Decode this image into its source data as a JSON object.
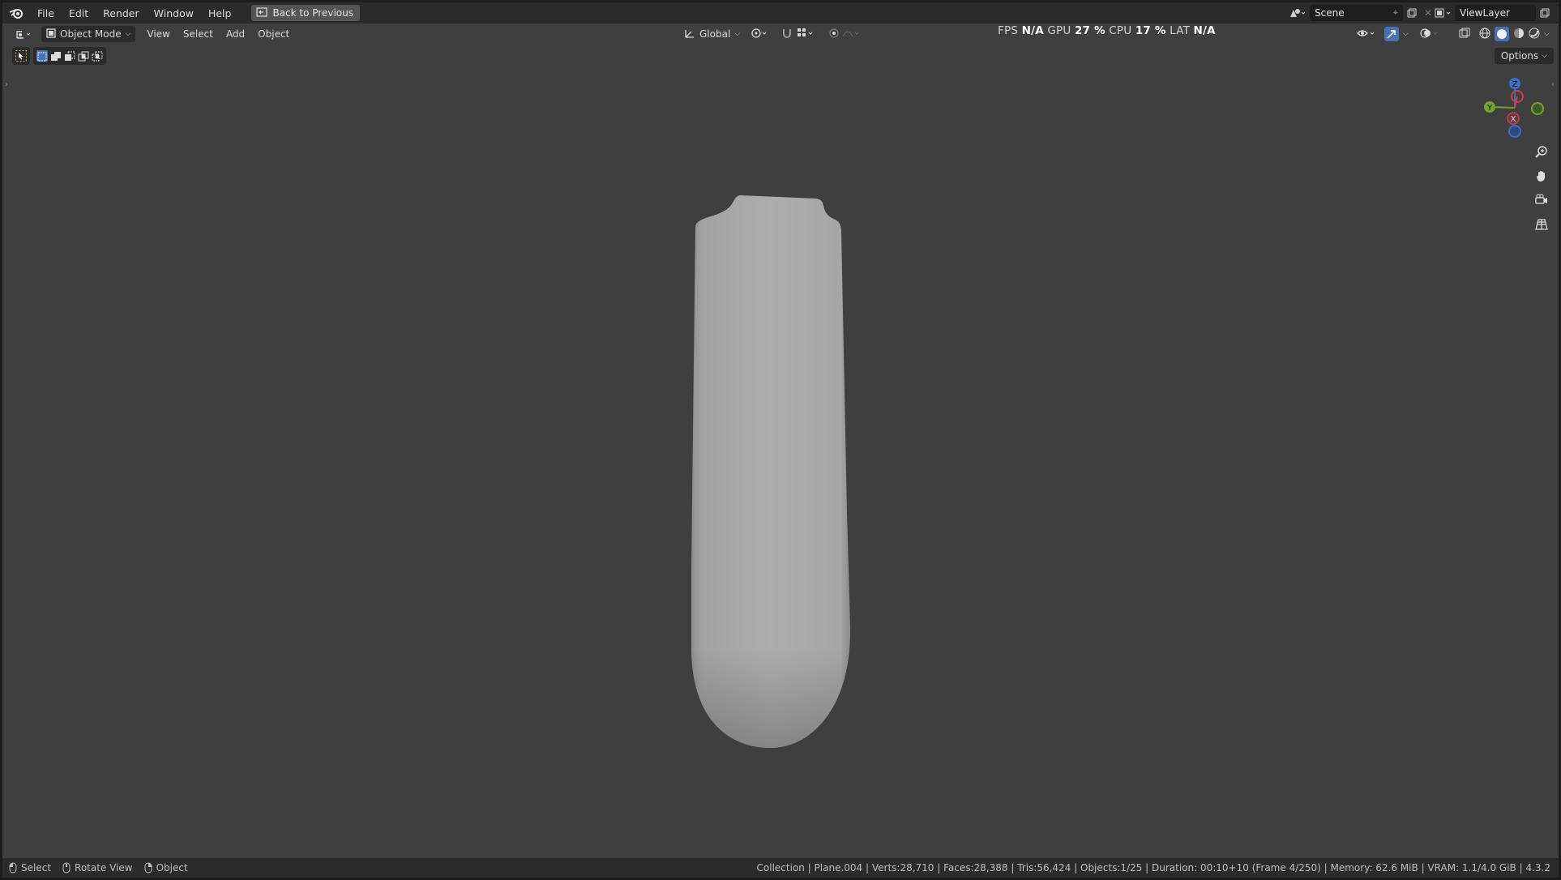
{
  "menubar": {
    "items": [
      "File",
      "Edit",
      "Render",
      "Window",
      "Help"
    ],
    "back_button": "Back to Previous"
  },
  "scene": {
    "label": "Scene"
  },
  "view_layer": {
    "label": "ViewLayer"
  },
  "viewport_header": {
    "mode": "Object Mode",
    "menus": [
      "View",
      "Select",
      "Add",
      "Object"
    ],
    "transform_orientation": "Global"
  },
  "perf_overlay": {
    "fps_label": "FPS",
    "fps_value": "N/A",
    "gpu_label": "GPU",
    "gpu_value": "27 %",
    "cpu_label": "CPU",
    "cpu_value": "17 %",
    "lat_label": "LAT",
    "lat_value": "N/A"
  },
  "options_button": "Options",
  "gizmo": {
    "z": "Z",
    "y": "Y",
    "x": "X"
  },
  "statusbar": {
    "select": "Select",
    "rotate": "Rotate View",
    "object": "Object",
    "info": "Collection | Plane.004 | Verts:28,710 | Faces:28,388 | Tris:56,424 | Objects:1/25 | Duration: 00:10+10 (Frame 4/250) | Memory: 62.6 MiB | VRAM: 1.1/4.0 GiB | 4.3.2"
  },
  "colors": {
    "viewport_bg": "#3f3f3f",
    "header_bg": "#2b2b2b",
    "axis_x": "#c8404f",
    "axis_y": "#6fa428",
    "axis_z": "#3b6fc8",
    "object": "#a9a9a9"
  }
}
